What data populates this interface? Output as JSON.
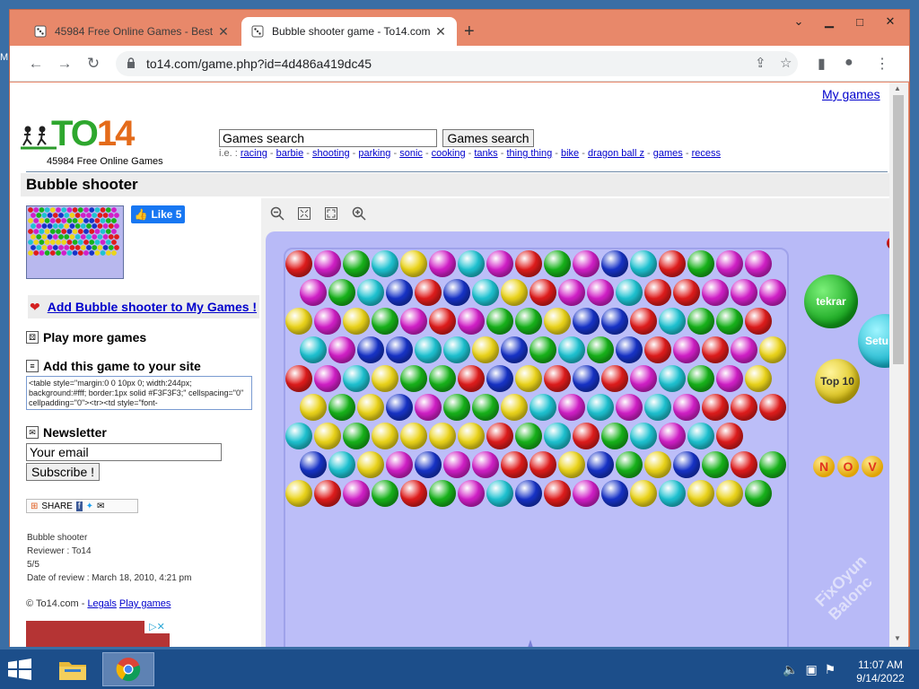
{
  "desktop": {
    "edge_glyph": "M"
  },
  "browser": {
    "tabs": [
      {
        "title": "45984 Free Online Games - Best",
        "icon": "dice-icon"
      },
      {
        "title": "Bubble shooter game - To14.com",
        "icon": "dice-icon",
        "active": true
      }
    ],
    "new_tab": "+",
    "address": "to14.com/game.php?id=4d486a419dc45",
    "window_controls": {
      "minimize": "▁",
      "maximize": "□",
      "close": "✕"
    }
  },
  "page": {
    "my_games": "My games",
    "logo_text": "TO14",
    "logo_sub": "45984 Free Online Games",
    "search_placeholder": "Games search",
    "search_button": "Games search",
    "quick_prefix": "i.e. :",
    "quick_links": [
      "racing",
      "barbie",
      "shooting",
      "parking",
      "sonic",
      "cooking",
      "tanks",
      "thing thing",
      "bike",
      "dragon ball z",
      "games",
      "recess"
    ],
    "title": "Bubble shooter",
    "fb_like": "Like 5",
    "add_to_my_games": "Add Bubble shooter to My Games !",
    "play_more": "Play more games",
    "add_to_site": "Add this game to your site",
    "embed_code": "<table style=\"margin:0 0 10px 0; width:244px; background:#fff; border:1px solid #F3F3F3;\" cellspacing=\"0\" cellpadding=\"0\"><tr><td style=\"font-",
    "newsletter": "Newsletter",
    "email_placeholder": "Your email",
    "subscribe": "Subscribe !",
    "share": "SHARE",
    "review": {
      "game": "Bubble shooter",
      "reviewer": "Reviewer : To14",
      "rating": "5/5",
      "date": "Date of review : March 18, 2010, 4:21 pm"
    },
    "footer": {
      "copyright": "© To14.com -",
      "legals": "Legals",
      "play_games": "Play games"
    }
  },
  "game": {
    "colors": {
      "R": "#e01c1c",
      "M": "#d21fc8",
      "G": "#17b31a",
      "C": "#1ec3d2",
      "Y": "#ecd51a",
      "B": "#1733c8"
    },
    "rows": [
      "RMGCYMCMRGMBCRGMM",
      "MGCBRBCYRMMCRRMMM",
      "YMYGMRMGGYBBRCGGR",
      "CMBBCCYBGCGBRMRMY",
      "RMCYGGRBYRBRMCGMY",
      "YGYBMGGYCMCMCMRRR",
      "CYGYYYYRGCRGCMCR",
      "BCYMBMMRRYBGYBGRG",
      "YRMGRGMCBRMBYCYYG"
    ],
    "buttons": {
      "restart": "tekrar",
      "setup": "Setu",
      "top10": "Top 10"
    },
    "letters": [
      "N",
      "O",
      "V"
    ],
    "watermark": "FixOyun Balonc"
  },
  "taskbar": {
    "clock_time": "11:07 AM",
    "clock_date": "9/14/2022",
    "apps": [
      "file-explorer-icon",
      "chrome-icon"
    ]
  }
}
